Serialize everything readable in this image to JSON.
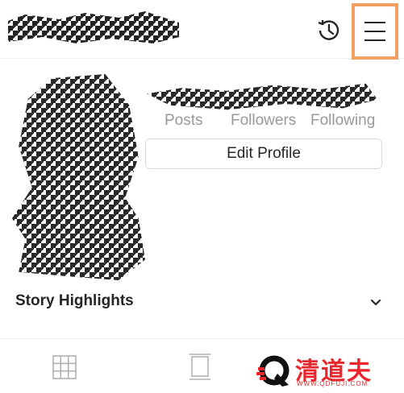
{
  "profile": {
    "stats": {
      "posts_label": "Posts",
      "followers_label": "Followers",
      "following_label": "Following"
    },
    "edit_profile_label": "Edit Profile"
  },
  "highlights": {
    "title": "Story Highlights"
  },
  "icons": {
    "history": "history-icon",
    "menu": "hamburger-menu-icon",
    "chevron": "chevron-down-icon",
    "grid": "grid-icon",
    "feed": "feed-icon"
  },
  "watermark": {
    "text": "清道夫",
    "url": "WWW.QDFUJI.COM",
    "color": "#e8262c"
  },
  "colors": {
    "menu_highlight": "#f0a060",
    "muted_text": "#999999"
  }
}
